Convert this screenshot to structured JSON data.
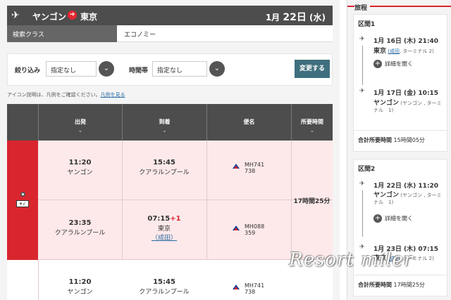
{
  "route": {
    "from": "ヤンゴン",
    "to": "東京",
    "date_prefix": "1月 ",
    "date_day": "22日",
    "date_suffix": " (水)"
  },
  "cabin": {
    "label": "検索クラス",
    "value": "エコノミー"
  },
  "filters": {
    "narrow_label": "絞り込み",
    "narrow_value": "指定なし",
    "time_label": "時間帯",
    "time_value": "指定なし",
    "change_button": "変更する"
  },
  "icon_note": {
    "text": "アイコン説明は、凡例をご確認ください。",
    "link": "凡例を見る"
  },
  "table": {
    "headers": [
      {
        "label": "出発"
      },
      {
        "label": "到着"
      },
      {
        "label": "便名"
      },
      {
        "label": "所要時間"
      }
    ],
    "option1": {
      "duration": "17時間25分",
      "legs": [
        {
          "dep_time": "11:20",
          "dep_city": "ヤンゴン",
          "arr_time": "15:45",
          "arr_city": "クアラルンプール",
          "flight": "MH741",
          "aircraft": "738"
        },
        {
          "dep_time": "23:35",
          "dep_city": "クアラルンプール",
          "arr_time": "07:15",
          "arr_plus": "+1",
          "arr_city": "東京",
          "arr_airport": "（成田）",
          "flight": "MH088",
          "aircraft": "359"
        }
      ]
    },
    "option2": {
      "legs": [
        {
          "dep_time": "11:20",
          "dep_city": "ヤンゴン",
          "arr_time": "15:45",
          "arr_city": "クアラルンプール",
          "flight": "MH741",
          "aircraft": "738"
        }
      ]
    }
  },
  "itinerary": {
    "title": "旅程",
    "segments": [
      {
        "header": "区間1",
        "dep_datetime": "1月 16日 (木) 21:40",
        "dep_city": "東京",
        "dep_airport": "(成田",
        "dep_terminal": ", ターミナル 2)",
        "detail_label": "詳細を開く",
        "arr_datetime": "1月 17日 (金) 10:15",
        "arr_city": "ヤンゴン",
        "arr_airport_1": "(ヤンゴン , ターミ",
        "arr_airport_2": "ナル　1)",
        "total_label": "合計所要時間",
        "total_value": "15時間05分"
      },
      {
        "header": "区間2",
        "dep_datetime": "1月 22日 (水) 11:20",
        "dep_city": "ヤンゴン",
        "dep_airport_1": "(ヤンゴン , ターミ",
        "dep_airport_2": "ナル　1)",
        "detail_label": "詳細を開く",
        "arr_datetime": "1月 23日 (木) 07:15",
        "arr_city": "東京",
        "arr_airport": "(成田",
        "arr_terminal": ", ターミナル 2)",
        "total_label": "合計所要時間",
        "total_value": "17時間25分"
      }
    ]
  },
  "watermark": "Resort miler",
  "colors": {
    "accent_red": "#d9262e",
    "header_gray": "#4d4d4d",
    "button_teal": "#3f6f7e",
    "row_pink": "#fde9ea"
  }
}
